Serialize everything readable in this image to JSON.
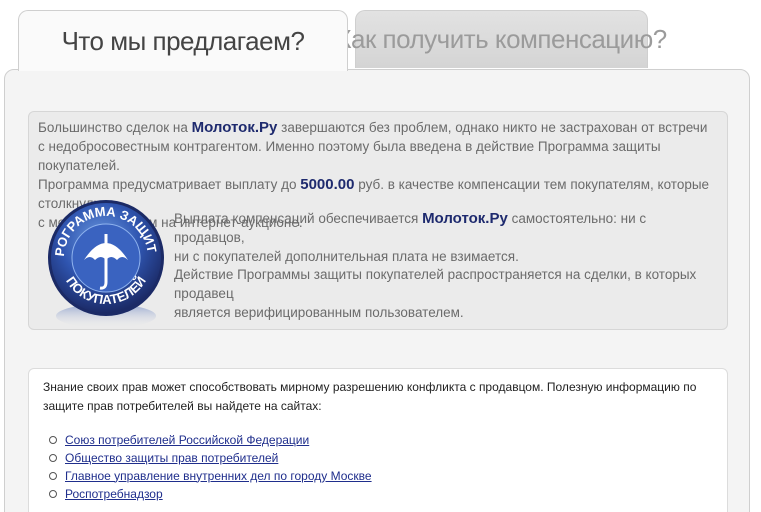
{
  "tabs": [
    {
      "label": "Что мы предлагаем?",
      "active": true
    },
    {
      "label": "Как получить компенсацию?",
      "active": false
    }
  ],
  "intro": {
    "part1": "Большинство сделок на ",
    "brand": "Молоток.Ру",
    "part2": " завершаются без проблем, однако никто не застрахован от встречи",
    "line2": "с недобросовестным контрагентом. Именно поэтому была введена в действие Программа защиты покупателей.",
    "line3a": "Программа предусматривает выплату до ",
    "amount": "5000.00",
    "line3b": " руб. в качестве компенсации тем покупателям, которые столкнулись",
    "line4": "с мошенничеством на интернет-аукционе."
  },
  "compensation": {
    "part1": "Выплата компенсаций обеспечивается ",
    "brand": "Молоток.Ру",
    "part2": " самостоятельно: ни с продавцов,",
    "line2": "ни с покупателей дополнительная плата не взимается."
  },
  "scope": {
    "line1": "Действие Программы защиты покупателей распространяется на сделки, в которых продавец",
    "line2": "является верифицированным пользователем."
  },
  "badge": {
    "top_text": "ПРОГРАММА ЗАЩИТЫ",
    "bottom_text": "ПОКУПАТЕЛЕЙ",
    "colors": {
      "outer": "#1b2a66",
      "inner": "#2f55b0",
      "highlight": "#6d9be0"
    }
  },
  "rights": {
    "text": "Знание своих прав может способствовать мирному разрешению конфликта с продавцом. Полезную информацию по защите прав потребителей вы найдете на сайтах:",
    "links": [
      "Союз потребителей Российской Федерации",
      "Общество защиты прав потребителей",
      "Главное управление внутренних дел по городу Москве",
      "Роспотребнадзор"
    ]
  }
}
